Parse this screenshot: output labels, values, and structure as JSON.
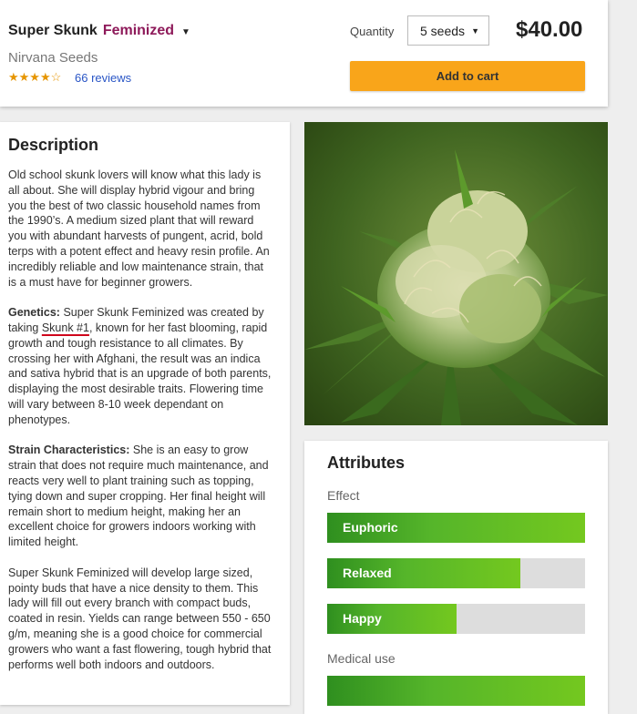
{
  "product": {
    "name": "Super Skunk",
    "variant": "Feminized",
    "brand": "Nirvana Seeds",
    "stars": "★★★★☆",
    "rating": 4,
    "reviews": "66 reviews"
  },
  "purchase": {
    "quantity_label": "Quantity",
    "quantity_value": "5 seeds",
    "price": "$40.00",
    "add_to_cart": "Add to cart"
  },
  "description": {
    "title": "Description",
    "p1": "Old school skunk lovers will know what this lady is all about. She will display hybrid vigour and bring you the best of two classic household names from the 1990’s. A medium sized plant that will reward you with abundant harvests of pungent, acrid, bold terps with a potent effect and heavy resin profile. An incredibly reliable and low maintenance strain, that is a must have for beginner growers.",
    "genetics_label": "Genetics:",
    "genetics_pre": " Super Skunk Feminized was created by taking",
    "genetics_link": "Skunk #1",
    "genetics_post": ", known for her fast blooming, rapid growth and tough resistance to all climates. By crossing her with Afghani, the result was an indica and sativa hybrid that is an upgrade of both parents, displaying the most desirable traits. Flowering time will vary between 8-10 week dependant on phenotypes.",
    "strain_label": "Strain Characteristics:",
    "strain_text": " She is an easy to grow strain that does not require much maintenance, and reacts very well to plant training such as topping, tying down and super cropping. Her final height will remain short to medium height, making her an excellent choice for growers indoors working with limited height.",
    "p4": "Super Skunk Feminized will develop large sized, pointy buds that have a nice density to them. This lady will fill out every branch with compact buds, coated in resin. Yields can range between 550 - 650 g/m, meaning she is a good choice for commercial growers who want a fast flowering, tough hybrid that performs well both indoors and outdoors."
  },
  "attributes": {
    "title": "Attributes",
    "effect_label": "Effect",
    "effects": [
      {
        "label": "Euphoric",
        "level": 1.0
      },
      {
        "label": "Relaxed",
        "level": 0.75
      },
      {
        "label": "Happy",
        "level": 0.5
      }
    ],
    "medical_label": "Medical use",
    "medical_level": 1.0
  },
  "colors": {
    "variant": "#8e1a5a",
    "button": "#f9a51a",
    "link": "#2a56c6",
    "bar_fill": "#5cb82a",
    "bar_track": "#dddddd"
  }
}
